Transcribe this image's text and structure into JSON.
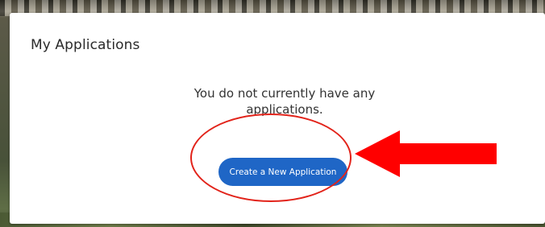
{
  "card": {
    "title": "My Applications",
    "empty_message": "You do not currently have any applications."
  },
  "actions": {
    "create_label": "Create a New Application"
  },
  "annotations": {
    "highlight_color": "#e2231a",
    "arrow_color": "#ff0000"
  },
  "theme": {
    "button_color": "#1f66c6"
  }
}
